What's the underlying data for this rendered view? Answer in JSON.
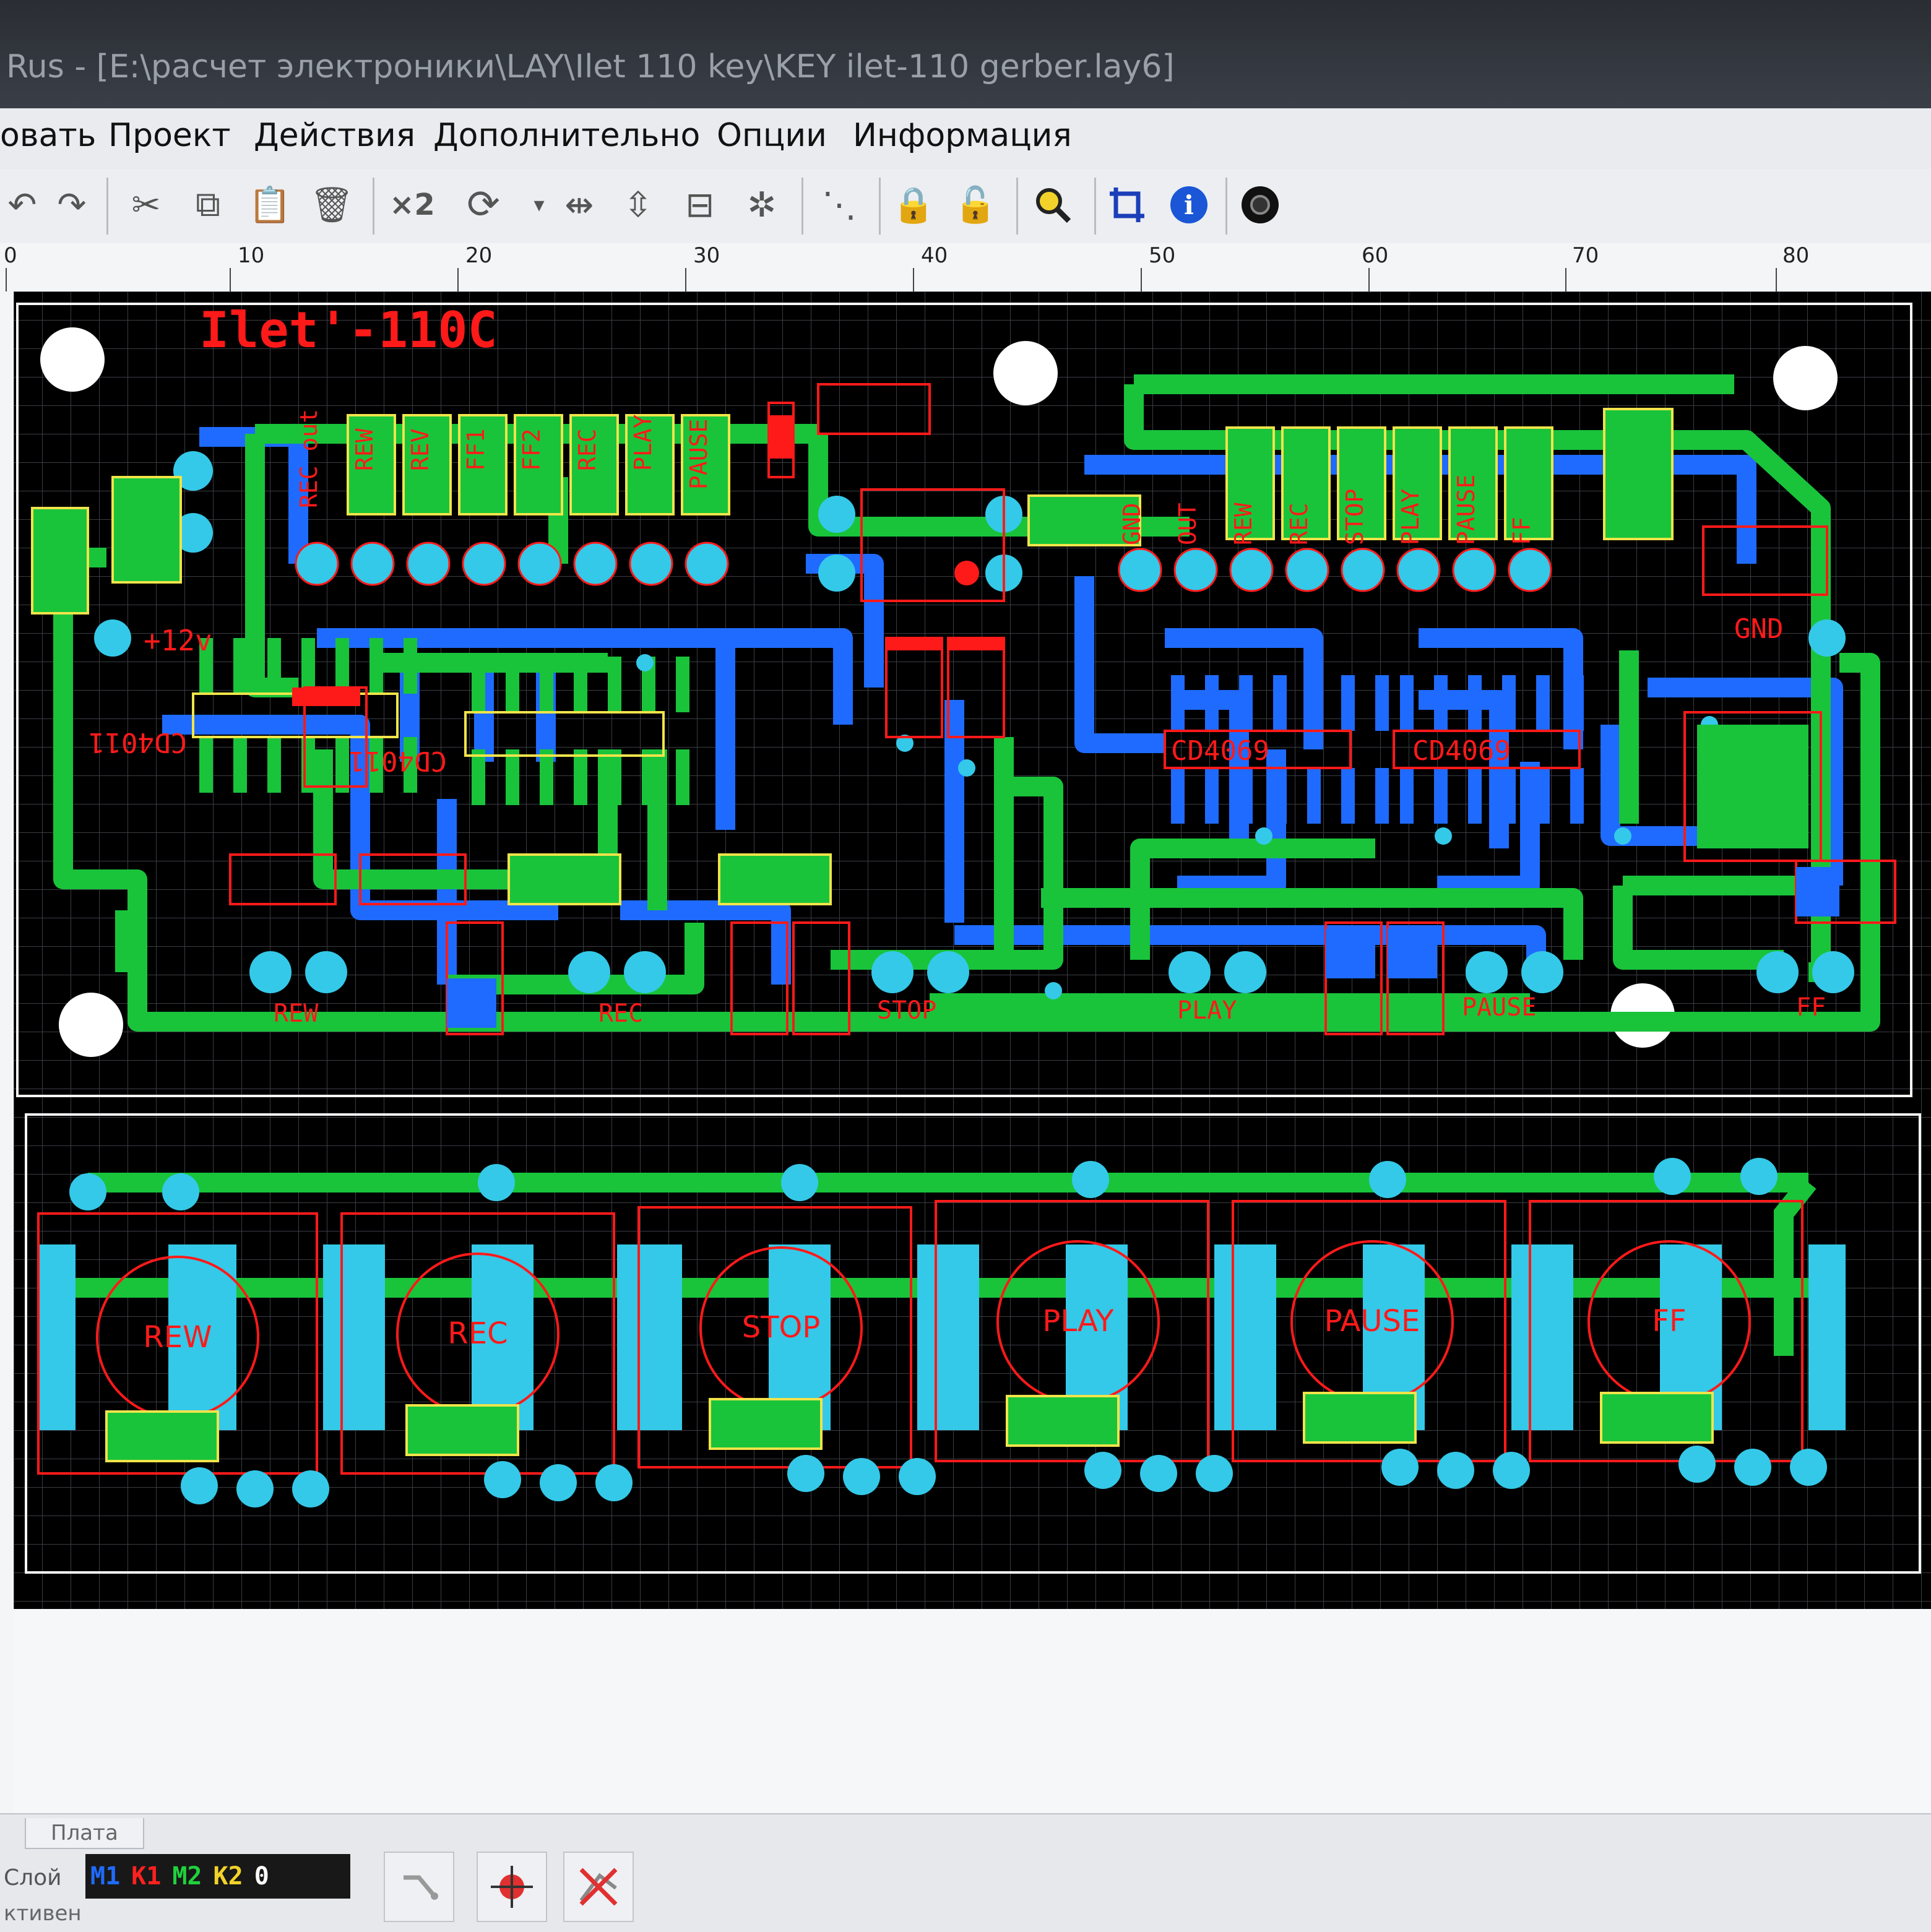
{
  "window": {
    "title": "Rus - [E:\\расчет электроники\\LAY\\Ilet 110 key\\KEY ilet-110 gerber.lay6]"
  },
  "menu": {
    "items": [
      "овать",
      "Проект",
      "Действия",
      "Дополнительно",
      "Опции",
      "Информация"
    ]
  },
  "toolbar": {
    "zoom_label": "×2",
    "icons": [
      "undo-icon",
      "redo-icon",
      "cut-icon",
      "copy-icon",
      "paste-icon",
      "delete-icon",
      "rotate-icon",
      "mirror-h-icon",
      "mirror-v-icon",
      "align-icon",
      "group-icon",
      "snap-icon",
      "lock-icon",
      "unlock-icon",
      "search-icon",
      "crop-icon",
      "info-icon",
      "component-icon"
    ]
  },
  "ruler": {
    "labels": [
      "0",
      "10",
      "20",
      "30",
      "40",
      "50",
      "60",
      "70",
      "80"
    ]
  },
  "board": {
    "title": "Ilet'-110C",
    "colors": {
      "m1": "#1f6bff",
      "m2": "#19c43b",
      "silk": "#ff1a1a",
      "pad": "#34c9e8",
      "outline": "#f0e44a"
    },
    "top_labels": [
      "REC out",
      "REW",
      "REV",
      "FF1",
      "FF2",
      "REC",
      "PLAY",
      "PAUSE"
    ],
    "right_labels": [
      "GND",
      "OUT",
      "REW",
      "REC",
      "STOP",
      "PLAY",
      "PAUSE",
      "FF"
    ],
    "power_label": "+12v",
    "gnd_label": "GND",
    "chips": [
      "CD4011",
      "CD4011",
      "CD4069",
      "CD4069"
    ],
    "bottom_labels": [
      "REW",
      "REC",
      "STOP",
      "PLAY",
      "PAUSE",
      "FF"
    ],
    "buttons": [
      "REW",
      "REC",
      "STOP",
      "PLAY",
      "PAUSE",
      "FF"
    ]
  },
  "status": {
    "tab_label": "Плата",
    "layer_label": "Слой",
    "active_label": "ктивен",
    "layers": [
      {
        "name": "M1",
        "color": "#1f6bff"
      },
      {
        "name": "K1",
        "color": "#ff2020"
      },
      {
        "name": "M2",
        "color": "#1fd13c"
      },
      {
        "name": "K2",
        "color": "#f2d22a"
      },
      {
        "name": "0",
        "color": "#ffffff"
      }
    ]
  }
}
